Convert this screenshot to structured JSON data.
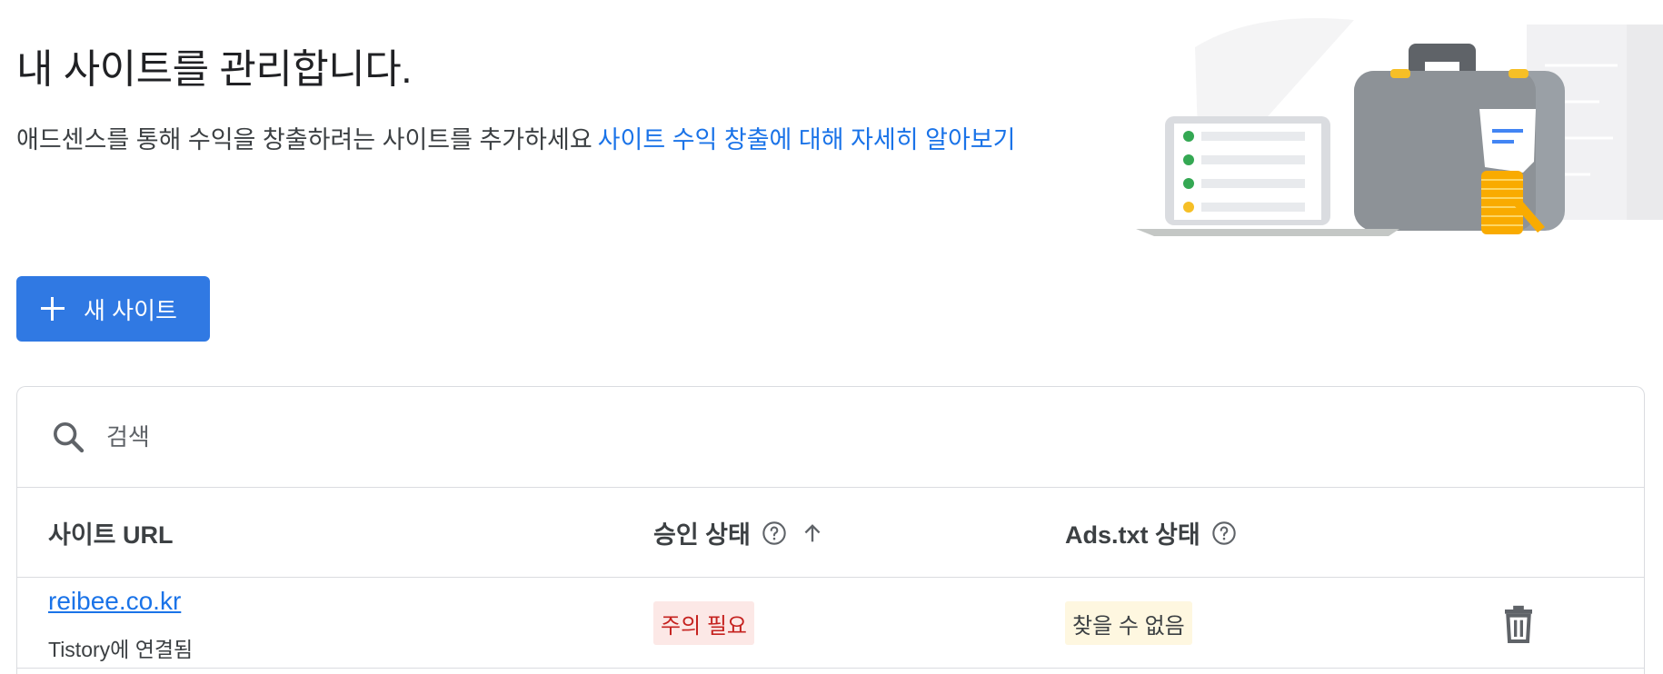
{
  "header": {
    "title": "내 사이트를 관리합니다.",
    "description": "애드센스를 통해 수익을 창출하려는 사이트를 추가하세요",
    "learn_more_link": "사이트 수익 창출에 대해 자세히 알아보기"
  },
  "toolbar": {
    "new_site_label": "새 사이트"
  },
  "search": {
    "placeholder": "검색",
    "value": ""
  },
  "table": {
    "columns": [
      {
        "label": "사이트 URL"
      },
      {
        "label": "승인 상태",
        "help_icon": "help-circle-icon",
        "sort_icon": "arrow-up-icon"
      },
      {
        "label": "Ads.txt 상태",
        "help_icon": "help-circle-icon"
      }
    ],
    "rows": [
      {
        "site_url": "reibee.co.kr",
        "connection": "Tistory에 연결됨",
        "approval_status": "주의 필요",
        "ads_txt_status": "찾을 수 없음",
        "delete_icon": "trash-icon"
      }
    ]
  },
  "colors": {
    "accent": "#1a73e8",
    "button": "#3079e3",
    "warning_bg": "#fce8e6",
    "warning_text": "#c5221f",
    "notfound_bg": "#fef7e0"
  }
}
